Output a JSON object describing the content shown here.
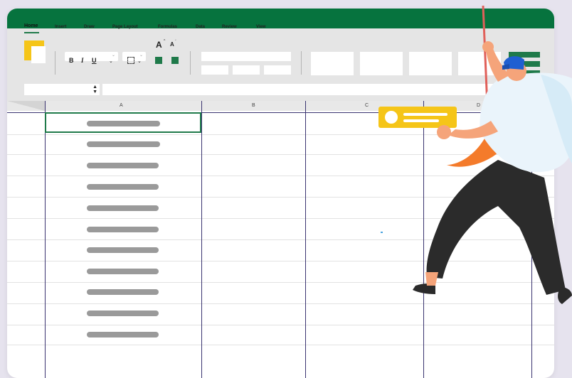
{
  "ribbon": {
    "tabs": [
      {
        "label": "Home",
        "active": true
      },
      {
        "label": "Insert"
      },
      {
        "label": "Draw"
      },
      {
        "label": "Page Layout"
      },
      {
        "label": "Formulas"
      },
      {
        "label": "Data"
      },
      {
        "label": "Review"
      },
      {
        "label": "View"
      }
    ],
    "font_grow_label": "A",
    "font_shrink_label": "A",
    "bold_label": "B",
    "italic_label": "I",
    "underline_label": "U"
  },
  "columns": [
    "A",
    "B",
    "C",
    "D"
  ],
  "colors": {
    "title_bar": "#06733e",
    "accent_green": "#1f7a4a",
    "clipboard_yellow": "#f5c518",
    "ribbon_bg": "#e5e5e5",
    "page_bg": "#e6e3ee"
  },
  "icons": [
    "clipboard-icon",
    "font-size-increase-icon",
    "font-size-decrease-icon",
    "borders-icon",
    "fill-color-icon",
    "font-color-icon",
    "excel-logo-icon"
  ]
}
